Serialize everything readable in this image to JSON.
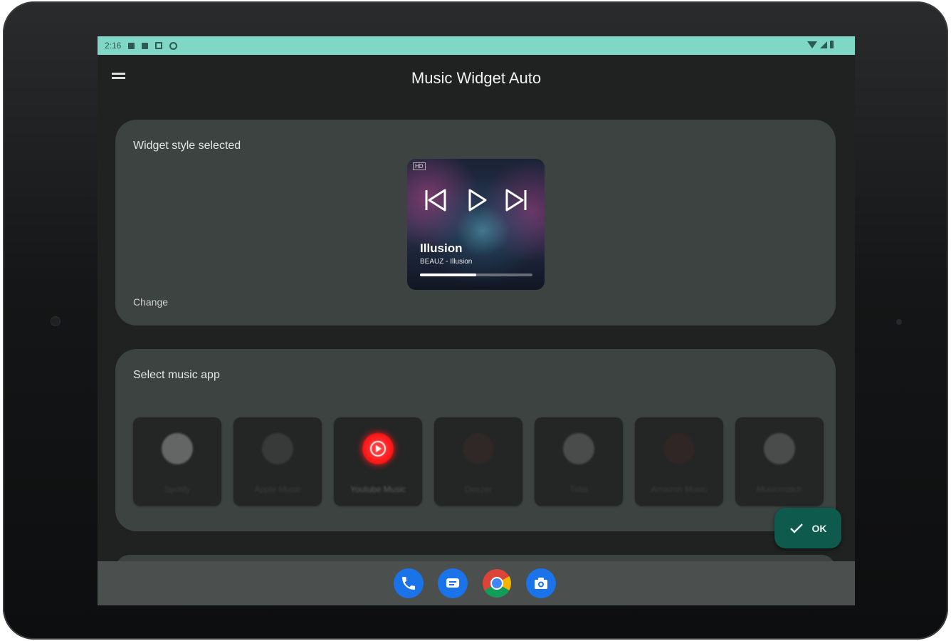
{
  "statusbar": {
    "time": "2:16"
  },
  "header": {
    "title": "Music Widget Auto"
  },
  "style_card": {
    "label": "Widget style selected",
    "change_label": "Change",
    "preview": {
      "badge": "HD",
      "song_title": "Illusion",
      "song_subtitle": "BEAUZ - Illusion",
      "progress": 0.5
    }
  },
  "app_card": {
    "label": "Select music app",
    "apps": [
      {
        "name": "Spotify",
        "icon": "spotify-icon",
        "color": "#9a9a9a",
        "selected": false
      },
      {
        "name": "Apple Music",
        "icon": "apple-music-icon",
        "color": "#4a4a4a",
        "selected": false
      },
      {
        "name": "Youtube Music",
        "icon": "youtube-music-icon",
        "color": "#ff1a1a",
        "selected": true
      },
      {
        "name": "Deezer",
        "icon": "deezer-icon",
        "color": "#3a2a2a",
        "selected": false
      },
      {
        "name": "Tidal",
        "icon": "tidal-icon",
        "color": "#6b6b6b",
        "selected": false
      },
      {
        "name": "Amazon Music",
        "icon": "amazon-music-icon",
        "color": "#3a2626",
        "selected": false
      },
      {
        "name": "Musicmatch",
        "icon": "musixmatch-icon",
        "color": "#6b6b6b",
        "selected": false
      }
    ]
  },
  "ok_button": {
    "label": "OK"
  },
  "dock": [
    "phone-icon",
    "messages-icon",
    "chrome-icon",
    "camera-icon"
  ],
  "colors": {
    "statusbar": "#7fd7c5",
    "accent": "#0e5a4c",
    "card": "#3c4341",
    "background": "#1f2221"
  }
}
